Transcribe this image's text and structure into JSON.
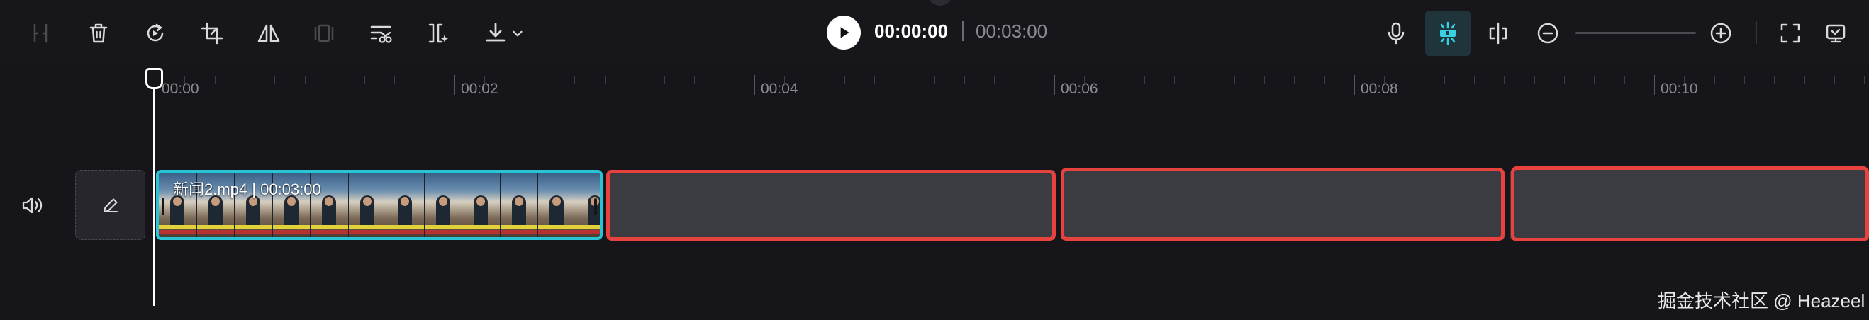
{
  "toolbar": {
    "tools": [
      {
        "name": "split-icon",
        "disabled": true
      },
      {
        "name": "delete-icon",
        "disabled": false
      },
      {
        "name": "replay-icon",
        "disabled": false
      },
      {
        "name": "crop-icon",
        "disabled": false
      },
      {
        "name": "mirror-icon",
        "disabled": false
      },
      {
        "name": "freeze-icon",
        "disabled": true
      },
      {
        "name": "trim-icon",
        "disabled": false
      },
      {
        "name": "auto-cut-icon",
        "disabled": false
      },
      {
        "name": "download-icon",
        "disabled": false
      }
    ],
    "right_tools": [
      "microphone-icon",
      "magnet-icon",
      "split-view-icon",
      "zoom-out-icon",
      "zoom-in-icon",
      "fullscreen-icon",
      "preview-icon"
    ]
  },
  "playback": {
    "current_time": "00:00:00",
    "total_time": "00:03:00"
  },
  "ruler": {
    "labels": [
      "00:00",
      "00:02",
      "00:04",
      "00:06",
      "00:08",
      "00:10"
    ]
  },
  "timeline": {
    "clip": {
      "label": "新闻2.mp4 | 00:03:00"
    }
  },
  "watermark": "掘金技术社区 @ Heazeel",
  "colors": {
    "selection": "#28c4d6",
    "highlight": "#e8423f",
    "active_tool_bg": "#20343b",
    "accent": "#3ad0e4"
  }
}
